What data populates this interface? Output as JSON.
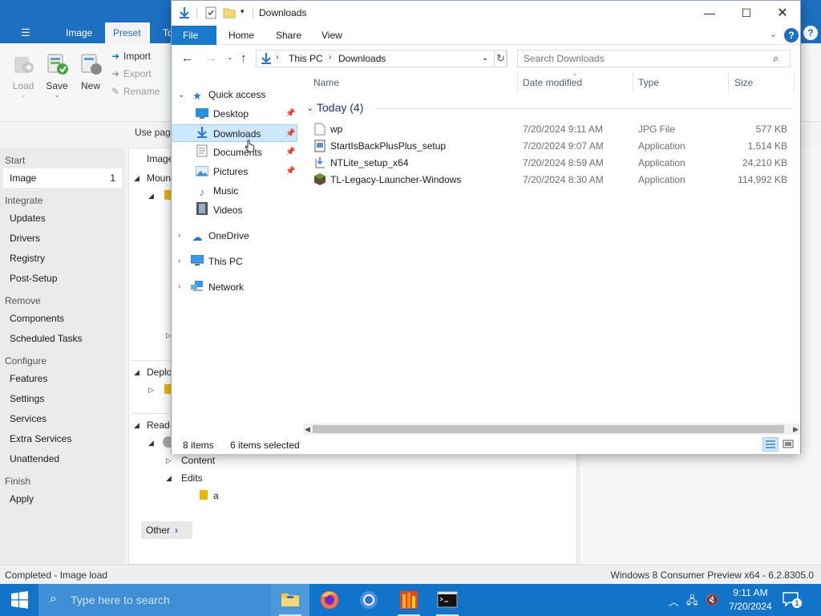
{
  "ntlite": {
    "tabs": [
      {
        "label": "Image"
      },
      {
        "label": "Preset"
      },
      {
        "label": "To"
      }
    ],
    "ribbon": {
      "load": "Load",
      "save": "Save",
      "new": "New",
      "import": "Import",
      "export": "Export",
      "rename": "Rename"
    },
    "use_page": "Use page",
    "sidebar": {
      "start_head": "Start",
      "image_item": "Image",
      "image_count": "1",
      "integrate_head": "Integrate",
      "updates": "Updates",
      "drivers": "Drivers",
      "registry": "Registry",
      "post_setup": "Post-Setup",
      "remove_head": "Remove",
      "components": "Components",
      "scheduled_tasks": "Scheduled Tasks",
      "configure_head": "Configure",
      "features": "Features",
      "settings": "Settings",
      "services": "Services",
      "extra_services": "Extra Services",
      "unattended": "Unattended",
      "finish_head": "Finish",
      "apply": "Apply"
    },
    "main": {
      "image_col": "Image",
      "mount": "Moun",
      "deploy": "Deplo",
      "readonly": "Read-",
      "content": "Content",
      "edits": "Edits",
      "edits_child": "a",
      "other": "Other"
    },
    "status_left": "Completed - Image load",
    "status_right": "Windows 8 Consumer Preview x64 - 6.2.8305.0"
  },
  "explorer": {
    "title": "Downloads",
    "ribbon_tabs": [
      "File",
      "Home",
      "Share",
      "View"
    ],
    "address": {
      "segments": [
        "This PC",
        "Downloads"
      ]
    },
    "search_placeholder": "Search Downloads",
    "nav": {
      "quick_access": "Quick access",
      "desktop": "Desktop",
      "downloads": "Downloads",
      "documents": "Documents",
      "pictures": "Pictures",
      "music": "Music",
      "videos": "Videos",
      "onedrive": "OneDrive",
      "this_pc": "This PC",
      "network": "Network"
    },
    "columns": {
      "name": "Name",
      "date_modified": "Date modified",
      "type": "Type",
      "size": "Size"
    },
    "group_label": "Today (4)",
    "files": [
      {
        "name": "wp",
        "date": "7/20/2024 9:11 AM",
        "type": "JPG File",
        "size": "577 KB",
        "icon": "jpg-file-icon"
      },
      {
        "name": "StartIsBackPlusPlus_setup",
        "date": "7/20/2024 9:07 AM",
        "type": "Application",
        "size": "1,514 KB",
        "icon": "installer-icon"
      },
      {
        "name": "NTLite_setup_x64",
        "date": "7/20/2024 8:59 AM",
        "type": "Application",
        "size": "24,210 KB",
        "icon": "setup-icon"
      },
      {
        "name": "TL-Legacy-Launcher-Windows",
        "date": "7/20/2024 8:30 AM",
        "type": "Application",
        "size": "114,992 KB",
        "icon": "minecraft-icon"
      }
    ],
    "status": {
      "items": "8 items",
      "selected": "6 items selected"
    }
  },
  "taskbar": {
    "search_placeholder": "Type here to search",
    "time": "9:11 AM",
    "date": "7/20/2024",
    "notification_count": "1"
  },
  "colors": {
    "accent": "#1d6fc1",
    "taskbar": "#1174c9",
    "selection": "#cce8ff"
  }
}
